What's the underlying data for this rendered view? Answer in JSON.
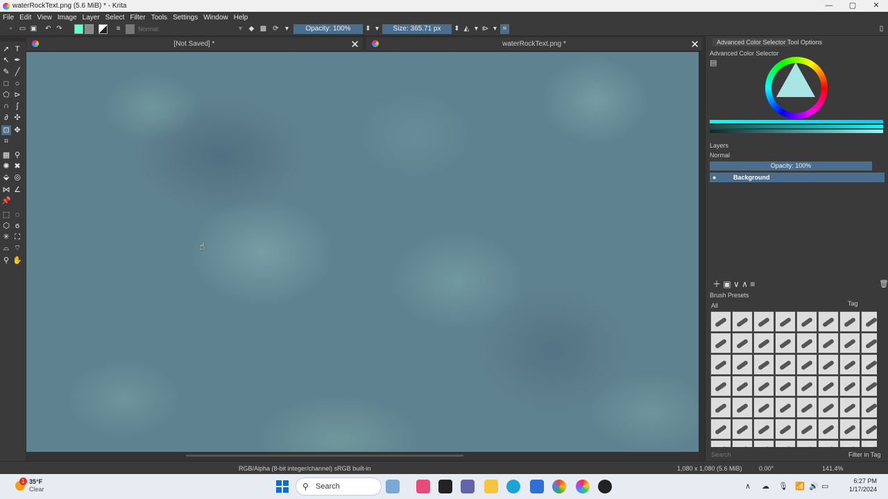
{
  "window": {
    "title": "waterRockText.png (5.6 MiB)  * - Krita",
    "minimize": "—",
    "maximize": "▢",
    "close": "✕"
  },
  "menu": [
    "File",
    "Edit",
    "View",
    "Image",
    "Layer",
    "Select",
    "Filter",
    "Tools",
    "Settings",
    "Window",
    "Help"
  ],
  "toolbar": {
    "blend_mode": "Normal",
    "opacity": "Opacity: 100%",
    "size": "Size: 365.71 px"
  },
  "tabs": [
    {
      "title": "[Not Saved]  *",
      "close": "✕"
    },
    {
      "title": "waterRockText.png  *",
      "close": "✕"
    }
  ],
  "right_dock": {
    "tabs": [
      "Advanced Color Selector",
      "Tool Options"
    ],
    "color_selector_title": "Advanced Color Selector",
    "layers_title": "Layers",
    "layers_blend": "Normal",
    "layers_opacity": "Opacity: 100%",
    "layer_name": "Background",
    "brush_presets_title": "Brush Presets",
    "brush_filter": "All",
    "brush_tag": "Tag",
    "brush_search_placeholder": "Search",
    "filter_in_tag": "Filter in Tag"
  },
  "status": {
    "color_space": "RGB/Alpha (8-bit integer/channel)  sRGB built-in",
    "dimensions": "1,080 x 1,080 (5.6 MiB)",
    "rotation": "0.00°",
    "zoom": "141.4%"
  },
  "taskbar": {
    "weather_temp": "35°F",
    "weather_cond": "Clear",
    "search_label": "Search",
    "time": "6:27 PM",
    "date": "1/17/2024"
  },
  "colors": {
    "accent": "#4b6e8e",
    "canvas_base": "#5f8290",
    "ui_bg": "#3a3a3a"
  }
}
